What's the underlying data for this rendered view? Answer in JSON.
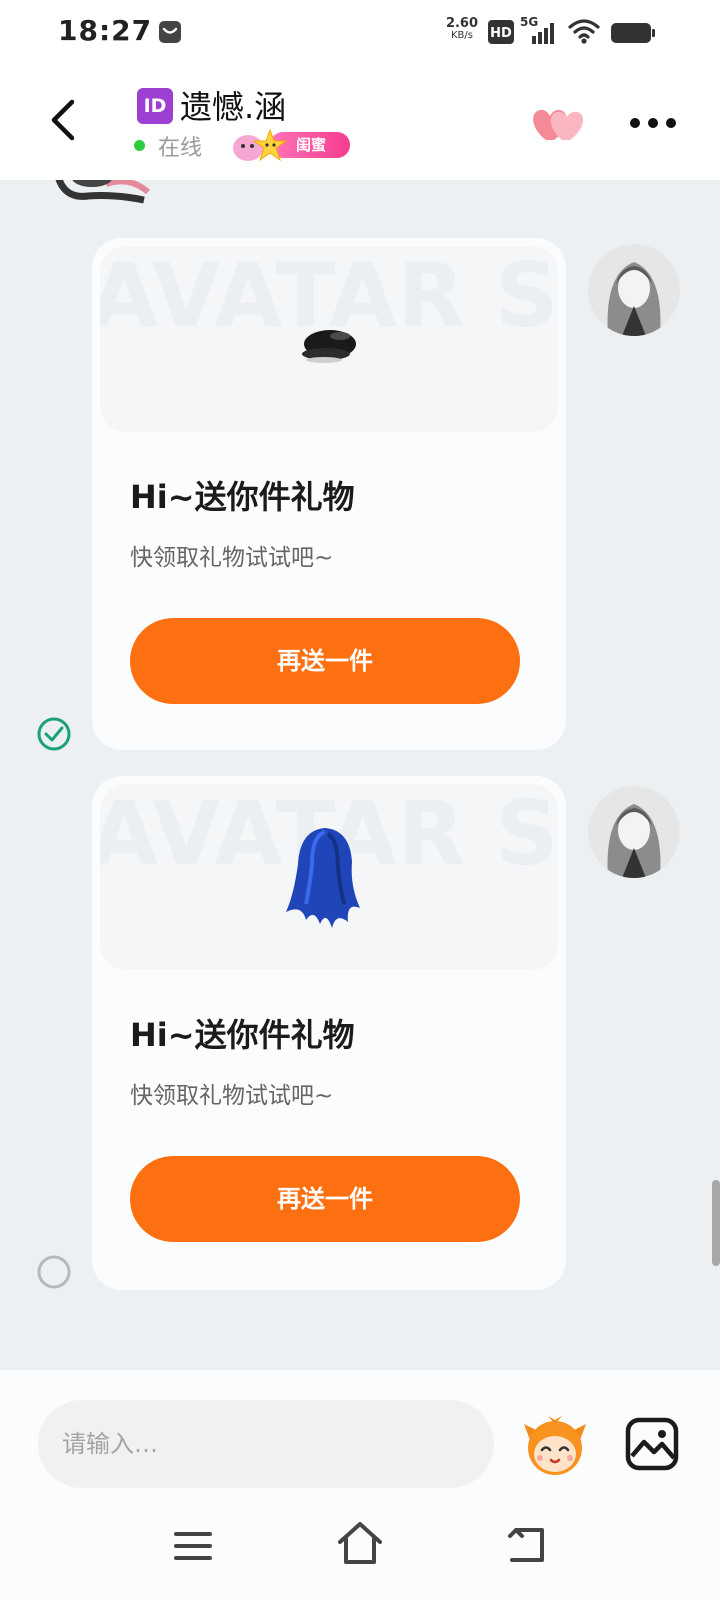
{
  "status_bar": {
    "time": "18:27",
    "net_speed_value": "2.60",
    "net_speed_unit": "KB/s",
    "hd_label": "HD",
    "network_type": "5G",
    "icons": [
      "notification-icon",
      "hd-icon",
      "signal-icon",
      "wifi-icon",
      "battery-icon"
    ]
  },
  "header": {
    "id_badge": "ID",
    "name": "遗憾.涵",
    "status": "在线",
    "relation": "闺蜜",
    "icons": [
      "back-icon",
      "hearts-icon",
      "more-icon"
    ]
  },
  "messages": [
    {
      "banner_watermark": "AVATAR STORE",
      "gift_item": "black-beret-icon",
      "title": "Hi~送你件礼物",
      "subtitle": "快领取礼物试试吧~",
      "button_label": "再送一件",
      "selected": true
    },
    {
      "banner_watermark": "AVATAR STORE",
      "gift_item": "blue-hair-icon",
      "title": "Hi~送你件礼物",
      "subtitle": "快领取礼物试试吧~",
      "button_label": "再送一件",
      "selected": false
    }
  ],
  "input": {
    "placeholder": "请输入…",
    "value": ""
  },
  "colors": {
    "accent": "#fd7012",
    "online": "#2ecc40",
    "check": "#1aa178",
    "relation_badge": "#f43c8d",
    "id_badge": "#9c3fd2"
  }
}
